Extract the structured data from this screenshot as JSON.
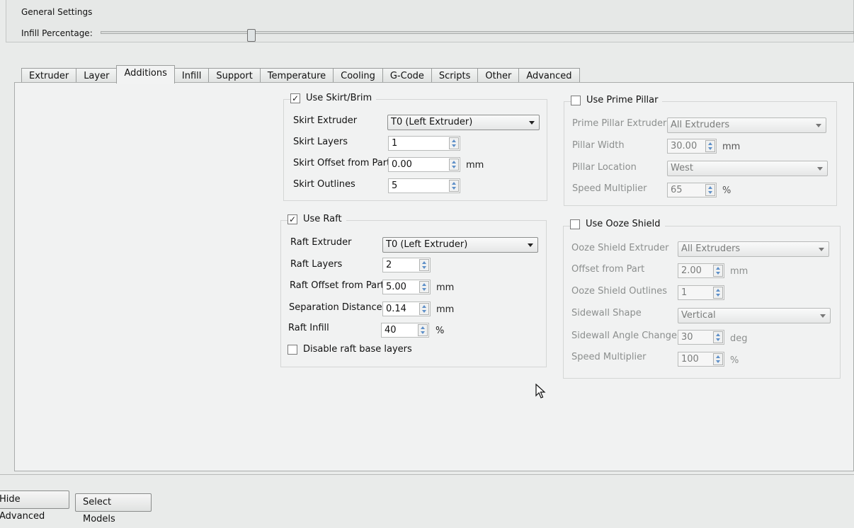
{
  "general": {
    "title": "General Settings",
    "infill_label": "Infill Percentage:"
  },
  "tabs": [
    {
      "label": "Extruder"
    },
    {
      "label": "Layer"
    },
    {
      "label": "Additions"
    },
    {
      "label": "Infill"
    },
    {
      "label": "Support"
    },
    {
      "label": "Temperature"
    },
    {
      "label": "Cooling"
    },
    {
      "label": "G-Code"
    },
    {
      "label": "Scripts"
    },
    {
      "label": "Other"
    },
    {
      "label": "Advanced"
    }
  ],
  "active_tab": "Additions",
  "skirt": {
    "title": "Use Skirt/Brim",
    "checked": true,
    "extruder_label": "Skirt Extruder",
    "extruder_value": "T0 (Left Extruder)",
    "layers_label": "Skirt Layers",
    "layers_value": "1",
    "offset_label": "Skirt Offset from Part",
    "offset_value": "0.00",
    "offset_unit": "mm",
    "outlines_label": "Skirt Outlines",
    "outlines_value": "5"
  },
  "raft": {
    "title": "Use Raft",
    "checked": true,
    "extruder_label": "Raft Extruder",
    "extruder_value": "T0 (Left Extruder)",
    "layers_label": "Raft Layers",
    "layers_value": "2",
    "offset_label": "Raft Offset from Part",
    "offset_value": "5.00",
    "offset_unit": "mm",
    "separation_label": "Separation Distance",
    "separation_value": "0.14",
    "separation_unit": "mm",
    "infill_label": "Raft Infill",
    "infill_value": "40",
    "infill_unit": "%",
    "disable_base_label": "Disable raft base layers",
    "disable_base_checked": false
  },
  "prime": {
    "title": "Use Prime Pillar",
    "checked": false,
    "extruder_label": "Prime Pillar Extruder",
    "extruder_value": "All Extruders",
    "width_label": "Pillar Width",
    "width_value": "30.00",
    "width_unit": "mm",
    "location_label": "Pillar Location",
    "location_value": "West",
    "speed_label": "Speed Multiplier",
    "speed_value": "65",
    "speed_unit": "%"
  },
  "ooze": {
    "title": "Use Ooze Shield",
    "checked": false,
    "extruder_label": "Ooze Shield Extruder",
    "extruder_value": "All Extruders",
    "offset_label": "Offset from Part",
    "offset_value": "2.00",
    "offset_unit": "mm",
    "outlines_label": "Ooze Shield Outlines",
    "outlines_value": "1",
    "shape_label": "Sidewall Shape",
    "shape_value": "Vertical",
    "angle_label": "Sidewall Angle Change",
    "angle_value": "30",
    "angle_unit": "deg",
    "speed_label": "Speed Multiplier",
    "speed_value": "100",
    "speed_unit": "%"
  },
  "bottom": {
    "hide_advanced": "Hide Advanced",
    "select_models": "Select Models"
  },
  "icons": {
    "check": "✓",
    "cursor": "mouse-pointer-icon",
    "dropdown": "chevron-down-icon",
    "spinner": "spin-arrows-icon"
  },
  "colors": {
    "background": "#e9ebea",
    "panel": "#f1f2f2",
    "disabled_text": "#8c8f8e",
    "spin_arrow": "#5d8fc8"
  },
  "slider": {
    "infill_fraction": 0.2
  }
}
